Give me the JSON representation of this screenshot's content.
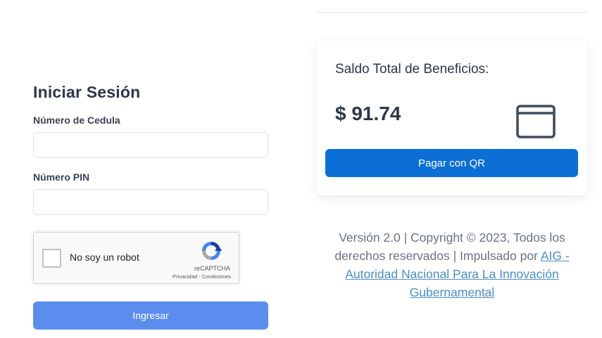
{
  "login": {
    "title": "Iniciar Sesión",
    "cedula_label": "Número de Cedula",
    "cedula_value": "",
    "pin_label": "Número PIN",
    "pin_value": "",
    "captcha": {
      "label": "No soy un robot",
      "brand": "reCAPTCHA",
      "links": "Privacidad - Condiciones",
      "checked": false
    },
    "submit_label": "Ingresar"
  },
  "balance_card": {
    "title": "Saldo Total de Beneficios:",
    "amount": "$ 91.74",
    "pay_button_label": "Pagar con QR",
    "icon": "wallet-icon"
  },
  "footer": {
    "text": "Versión 2.0 | Copyright © 2023, Todos los derechos reservados | Impulsado por ",
    "link_text": "AIG - Autoridad Nacional Para La Innovación Gubernamental"
  },
  "colors": {
    "primary_button": "#5b8def",
    "qr_button": "#0b6fd6",
    "link": "#4a8fc7"
  }
}
